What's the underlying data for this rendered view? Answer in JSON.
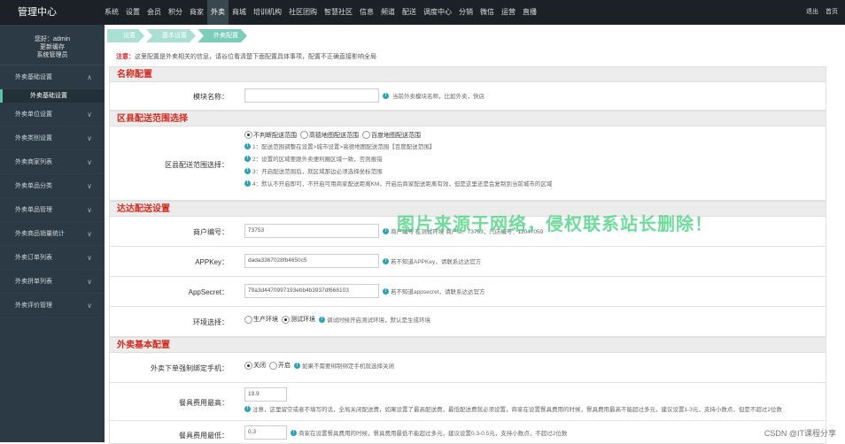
{
  "app": {
    "title": "管理中心"
  },
  "topnav": [
    "系统",
    "设置",
    "会员",
    "积分",
    "商家",
    "外卖",
    "商城",
    "培训机构",
    "社区团购",
    "智慧社区",
    "信息",
    "频道",
    "配送",
    "调度中心",
    "分销",
    "微信",
    "运营",
    "直播"
  ],
  "topnav_active": 5,
  "topright": {
    "logout": "退出",
    "home": "首页"
  },
  "user": {
    "greeting": "您好：admin",
    "refresh": "更新缓存",
    "role": "系统管理员"
  },
  "sidebar": {
    "items": [
      "外卖基础设置",
      "外卖单位设置",
      "外卖类别设置",
      "外卖商家列表",
      "外卖单品分类",
      "外卖单品管理",
      "外卖商品销量统计",
      "外卖订单列表",
      "外卖拼单列表",
      "外卖评价管理"
    ],
    "sub": "外卖基础设置"
  },
  "breadcrumb": [
    "设置",
    "基本设置",
    "外卖配置"
  ],
  "notice": {
    "label": "注意：",
    "text": "这里配置是外卖相关的信息，请谷位看清楚下面配置具体事项，配置不正确直接影响全局"
  },
  "sections": {
    "name": "名称配置",
    "area": "区县配送范围选择",
    "dada": "达达配送设置",
    "basic": "外卖基本配置"
  },
  "module": {
    "label": "模块名称：",
    "value": "",
    "hint": "当前外卖模块名称，比如外卖，快店"
  },
  "area": {
    "label": "区县配送范围选择：",
    "options": [
      "不判断配送范围",
      "高德地图配送范围",
      "百度地图配送范围"
    ],
    "selected": 0,
    "notes": [
      "1：配送范围调整在设置>城市设置>高德地图配送范围【百度配送范围】",
      "2：设置的区域要跟外卖便利圈区域一致，否则报错",
      "3：开启配送范围后，就区域那边必须选择坐标范围",
      "4：默认不开启即可，不开启可用商家配送距离KM，开启后商家配送距离有效，但是这里还是会复制到当前城市的区域"
    ]
  },
  "dada": {
    "merchant": {
      "label": "商户编号：",
      "value": "73753",
      "hint": "商户编号 在测试环境 商户id：73753，门店编号：11047059"
    },
    "appkey": {
      "label": "APPKey：",
      "value": "dada3367028fb4650c5",
      "hint": "若不知道APPKey，请联系达达官方"
    },
    "appsecret": {
      "label": "AppSecret：",
      "value": "79a3d4470997193ebb4b3937df668103",
      "hint": "若不知道appsecret，请联系达达官方"
    },
    "env": {
      "label": "环境选择：",
      "options": [
        "生产环境",
        "测试环境"
      ],
      "selected": 1,
      "hint": "调试时候开启测试环境，默认是生成环境"
    }
  },
  "basic": {
    "bindphone": {
      "label": "外卖下单强制绑定手机：",
      "options": [
        "关闭",
        "开启"
      ],
      "selected": 0,
      "hint": "如果不需要绑制绑定手机就选择关闭"
    },
    "feemax": {
      "label": "餐具费用最高：",
      "value": "19.9",
      "hint": "注意，这里留空或者不填写的话，全局关闭配送费，如果设置了最高配送费，最低配送费就必须设置，商家在设置餐具费用的时候，餐具费用最高不能超过多元，建议设置1-3元，支持小数点，但是不超过2位数"
    },
    "feemin": {
      "label": "餐具费用最低：",
      "value": "0.3",
      "hint": "商家在设置餐具费用的时候，餐具费用最低不能超过多元，建议设置0.3-0.5元，支持小数点，不超过2位数"
    }
  },
  "watermark": "图片来源于网络，侵权联系站长删除！",
  "credit": "CSDN @IT课程分享"
}
